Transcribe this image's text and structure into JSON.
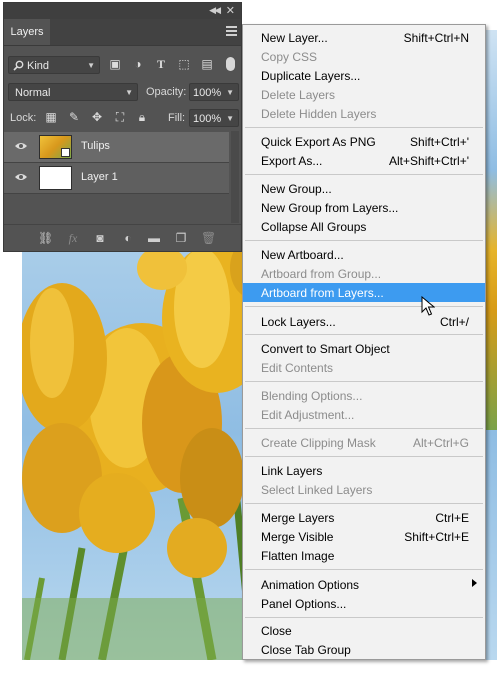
{
  "panel": {
    "tab_label": "Layers",
    "filter_kind": "Kind",
    "blend_mode": "Normal",
    "opacity_label": "Opacity:",
    "opacity_value": "100%",
    "lock_label": "Lock:",
    "fill_label": "Fill:",
    "fill_value": "100%",
    "layers": [
      {
        "name": "Tulips",
        "selected": true
      },
      {
        "name": "Layer 1",
        "selected": false
      }
    ],
    "bottom_icons": [
      "link-icon",
      "fx-icon",
      "mask-icon",
      "adjustment-icon",
      "folder-icon",
      "new-layer-icon",
      "trash-icon"
    ]
  },
  "menu": {
    "items": [
      {
        "label": "New Layer...",
        "shortcut": "Shift+Ctrl+N",
        "disabled": false
      },
      {
        "label": "Copy CSS",
        "shortcut": "",
        "disabled": true
      },
      {
        "label": "Duplicate Layers...",
        "shortcut": "",
        "disabled": false
      },
      {
        "label": "Delete Layers",
        "shortcut": "",
        "disabled": true
      },
      {
        "label": "Delete Hidden Layers",
        "shortcut": "",
        "disabled": true
      },
      {
        "label": "Quick Export As PNG",
        "shortcut": "Shift+Ctrl+'",
        "disabled": false
      },
      {
        "label": "Export As...",
        "shortcut": "Alt+Shift+Ctrl+'",
        "disabled": false
      },
      {
        "label": "New Group...",
        "shortcut": "",
        "disabled": false
      },
      {
        "label": "New Group from Layers...",
        "shortcut": "",
        "disabled": false
      },
      {
        "label": "Collapse All Groups",
        "shortcut": "",
        "disabled": false
      },
      {
        "label": "New Artboard...",
        "shortcut": "",
        "disabled": false
      },
      {
        "label": "Artboard from Group...",
        "shortcut": "",
        "disabled": true
      },
      {
        "label": "Artboard from Layers...",
        "shortcut": "",
        "disabled": false,
        "highlighted": true
      },
      {
        "label": "Lock Layers...",
        "shortcut": "Ctrl+/",
        "disabled": false
      },
      {
        "label": "Convert to Smart Object",
        "shortcut": "",
        "disabled": false
      },
      {
        "label": "Edit Contents",
        "shortcut": "",
        "disabled": true
      },
      {
        "label": "Blending Options...",
        "shortcut": "",
        "disabled": true
      },
      {
        "label": "Edit Adjustment...",
        "shortcut": "",
        "disabled": true
      },
      {
        "label": "Create Clipping Mask",
        "shortcut": "Alt+Ctrl+G",
        "disabled": true
      },
      {
        "label": "Link Layers",
        "shortcut": "",
        "disabled": false
      },
      {
        "label": "Select Linked Layers",
        "shortcut": "",
        "disabled": true
      },
      {
        "label": "Merge Layers",
        "shortcut": "Ctrl+E",
        "disabled": false
      },
      {
        "label": "Merge Visible",
        "shortcut": "Shift+Ctrl+E",
        "disabled": false
      },
      {
        "label": "Flatten Image",
        "shortcut": "",
        "disabled": false
      },
      {
        "label": "Animation Options",
        "shortcut": "",
        "disabled": false,
        "submenu": true
      },
      {
        "label": "Panel Options...",
        "shortcut": "",
        "disabled": false
      },
      {
        "label": "Close",
        "shortcut": "",
        "disabled": false
      },
      {
        "label": "Close Tab Group",
        "shortcut": "",
        "disabled": false
      }
    ]
  },
  "colors": {
    "panel_bg": "#535353",
    "menu_bg": "#f2f2f2",
    "highlight": "#3d9bf0",
    "disabled_text": "#8c8c8c"
  }
}
